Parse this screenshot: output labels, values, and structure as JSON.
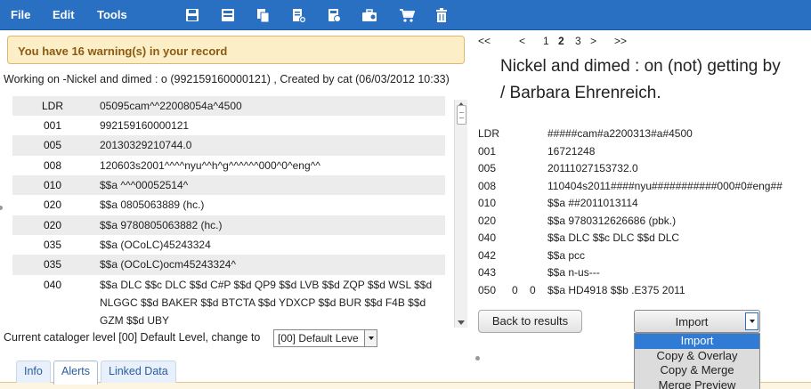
{
  "menubar": {
    "menus": [
      "File",
      "Edit",
      "Tools"
    ],
    "toolbar_icons": [
      "save-icon",
      "save-as-icon",
      "copy-icon",
      "add-record-icon",
      "save-to-file-icon",
      "briefcase-icon",
      "cart-icon",
      "trash-icon"
    ],
    "bg_color": "#2a70c2"
  },
  "warning": {
    "text": "You have 16 warning(s) in your record"
  },
  "working": {
    "text": "Working on -Nickel and dimed : o (992159160000121) , Created by cat (06/03/2012 10:33)"
  },
  "left_record": {
    "rows": [
      {
        "tag": "LDR",
        "value": "05095cam^^22008054a^4500"
      },
      {
        "tag": "001",
        "value": "992159160000121"
      },
      {
        "tag": "005",
        "value": "20130329210744.0"
      },
      {
        "tag": "008",
        "value": "120603s2001^^^^nyu^^h^g^^^^^^000^0^eng^^"
      },
      {
        "tag": "010",
        "value": "$$a ^^^00052514^"
      },
      {
        "tag": "020",
        "value": "$$a 0805063889 (hc.)"
      },
      {
        "tag": "020",
        "value": "$$a 9780805063882 (hc.)"
      },
      {
        "tag": "035",
        "value": "$$a (OCoLC)45243324"
      },
      {
        "tag": "035",
        "value": "$$a (OCoLC)ocm45243324^"
      },
      {
        "tag": "040",
        "value": "$$a DLC $$c DLC $$d C#P $$d QP9 $$d LVB $$d ZQP $$d WSL $$d NLGGC $$d BAKER $$d BTCTA $$d YDXCP $$d BUR $$d F4B $$d GZM $$d UBY"
      }
    ]
  },
  "catalog_level": {
    "label": "Current cataloger level [00] Default Level, change to",
    "selected": "[00] Default Leve"
  },
  "tabs": [
    "Info",
    "Alerts",
    "Linked Data"
  ],
  "active_tab": "Alerts",
  "pager": {
    "first": "<<",
    "prev": "<",
    "pages": [
      "1",
      "2",
      "3"
    ],
    "current": "2",
    "next": ">",
    "last": ">>"
  },
  "right_record": {
    "title_lines": [
      "Nickel and dimed : on (not) getting by",
      "/ Barbara Ehrenreich."
    ],
    "rows": [
      {
        "tag": "LDR",
        "ind1": "",
        "ind2": "",
        "value": "#####cam#a2200313#a#4500"
      },
      {
        "tag": "001",
        "ind1": "",
        "ind2": "",
        "value": "16721248"
      },
      {
        "tag": "005",
        "ind1": "",
        "ind2": "",
        "value": "20111027153732.0"
      },
      {
        "tag": "008",
        "ind1": "",
        "ind2": "",
        "value": "110404s2011####nyu###########000#0#eng##"
      },
      {
        "tag": "010",
        "ind1": "",
        "ind2": "",
        "value": "$$a ##2011013114"
      },
      {
        "tag": "020",
        "ind1": "",
        "ind2": "",
        "value": "$$a 9780312626686 (pbk.)"
      },
      {
        "tag": "040",
        "ind1": "",
        "ind2": "",
        "value": "$$a DLC $$c DLC $$d DLC"
      },
      {
        "tag": "042",
        "ind1": "",
        "ind2": "",
        "value": "$$a pcc"
      },
      {
        "tag": "043",
        "ind1": "",
        "ind2": "",
        "value": "$$a n-us---"
      },
      {
        "tag": "050",
        "ind1": "0",
        "ind2": "0",
        "value": "$$a HD4918 $$b .E375 2011"
      }
    ]
  },
  "buttons": {
    "back": "Back to results"
  },
  "import": {
    "selected": "Import",
    "options": [
      "Import",
      "Copy & Overlay",
      "Copy & Merge",
      "Merge Preview"
    ],
    "highlight_color": "#2f7bd6"
  }
}
